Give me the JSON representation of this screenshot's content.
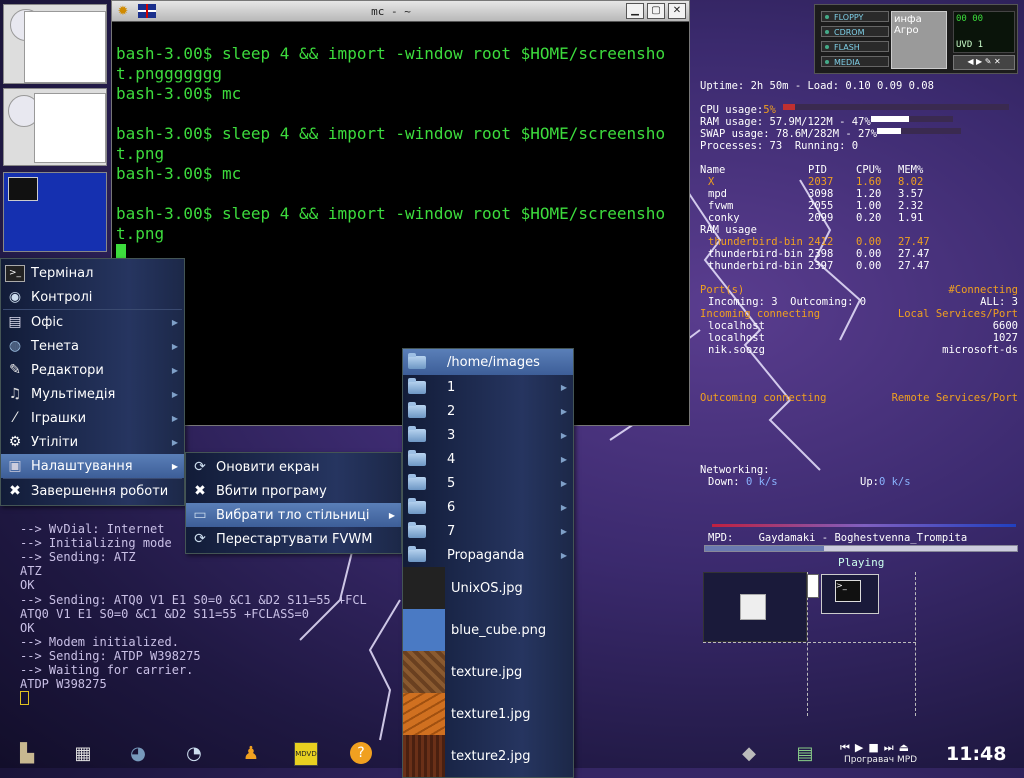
{
  "terminal": {
    "title": "mc - ~",
    "lines": [
      "bash-3.00$ sleep 4 && import -window root $HOME/screensho",
      "t.pnggggggg",
      "bash-3.00$ mc",
      "",
      "bash-3.00$ sleep 4 && import -window root $HOME/screensho",
      "t.png",
      "bash-3.00$ mc",
      "",
      "bash-3.00$ sleep 4 && import -window root $HOME/screensho",
      "t.png"
    ]
  },
  "console": {
    "lines": [
      "--> WvDial: Internet",
      "--> Initializing mode",
      "--> Sending: ATZ",
      "ATZ",
      "OK",
      "--> Sending: ATQ0 V1 E1 S0=0 &C1 &D2 S11=55 +FCL",
      "ATQ0 V1 E1 S0=0 &C1 &D2 S11=55 +FCLASS=0",
      "OK",
      "--> Modem initialized.",
      "--> Sending: ATDP W398275",
      "--> Waiting for carrier.",
      "ATDP W398275"
    ]
  },
  "main_menu": {
    "items": [
      {
        "label": "Термінал",
        "icon": "terminal-icon"
      },
      {
        "label": "Контролі",
        "icon": "globe-icon"
      },
      {
        "label": "Офіс",
        "icon": "document-icon"
      },
      {
        "label": "Тенета",
        "icon": "network-icon"
      },
      {
        "label": "Редактори",
        "icon": "editor-icon"
      },
      {
        "label": "Мультімедія",
        "icon": "multimedia-icon"
      },
      {
        "label": "Іграшки",
        "icon": "games-icon"
      },
      {
        "label": "Утіліти",
        "icon": "gear-icon"
      },
      {
        "label": "Налаштування",
        "icon": "settings-icon"
      },
      {
        "label": "Завершення роботи",
        "icon": "close-icon"
      }
    ]
  },
  "settings_menu": {
    "items": [
      {
        "label": "Оновити екран"
      },
      {
        "label": "Вбити програму"
      },
      {
        "label": "Вибрати тло стільниці"
      },
      {
        "label": "Перестартувати FVWM"
      }
    ]
  },
  "wallpaper_menu": {
    "header": "/home/images",
    "folders": [
      "1",
      "2",
      "3",
      "4",
      "5",
      "6",
      "7",
      "Propaganda"
    ],
    "images": [
      {
        "label": "UnixOS.jpg",
        "color": "#222"
      },
      {
        "label": "blue_cube.png",
        "color": "#4a7ac4"
      },
      {
        "label": "texture.jpg",
        "color": "#8a5a30"
      },
      {
        "label": "texture1.jpg",
        "color": "#d07020"
      },
      {
        "label": "texture2.jpg",
        "color": "#6a3018"
      }
    ]
  },
  "conky": {
    "uptime": "Uptime: 2h 50m - Load: 0.10 0.09 0.08",
    "cpu_label": "CPU usage:",
    "cpu_value": "5%",
    "cpu_fraction": 0.05,
    "ram_label": "RAM usage: 57.9M/122M - 47%",
    "ram_fraction": 0.47,
    "swap_label": "SWAP usage: 78.6M/282M - 27%",
    "swap_fraction": 0.27,
    "processes": "Processes: 73  Running: 0",
    "proc_header": [
      "Name",
      "PID",
      "CPU%",
      "MEM%"
    ],
    "proc_rows": [
      [
        "X",
        "2037",
        "1.60",
        "8.02"
      ],
      [
        "mpd",
        "3098",
        "1.20",
        "3.57"
      ],
      [
        "fvwm",
        "2055",
        "1.00",
        "2.32"
      ],
      [
        "conky",
        "2099",
        "0.20",
        "1.91"
      ]
    ],
    "ram_section": "RAM usage",
    "ram_rows": [
      [
        "thunderbird-bin",
        "2412",
        "0.00",
        "27.47"
      ],
      [
        "thunderbird-bin",
        "2398",
        "0.00",
        "27.47"
      ],
      [
        "thunderbird-bin",
        "2397",
        "0.00",
        "27.47"
      ]
    ],
    "ports_label": "Port(s)",
    "connecting": "#Connecting",
    "incoming_line": "Incoming: 3  Outcoming: 0",
    "all_line": "ALL: 3",
    "incoming_connecting": "Incoming connecting",
    "local_services": "Local Services/Port",
    "connections": [
      [
        "localhost",
        "6600"
      ],
      [
        "localhost",
        "1027"
      ],
      [
        "nik.soozg",
        "microsoft-ds"
      ]
    ],
    "outcoming_connecting": "Outcoming connecting",
    "remote_services": "Remote Services/Port",
    "networking": "Networking:",
    "down_label": "Down:",
    "down_value": "0 k/s",
    "up_label": "Up:",
    "up_value": "0 k/s",
    "mpd_label": "MPD:",
    "mpd_track": "Gaydamaki - Boghestvenna_Trompita",
    "mpd_status": "Playing"
  },
  "dock": {
    "buttons": [
      "FLOPPY",
      "CDROM",
      "FLASH",
      "MEDIA"
    ],
    "note_text": "инфа Агро",
    "clock_display": "00 00",
    "uvd": "UVD 1"
  },
  "taskbar": {
    "player_label": "Програвач MPD",
    "clock": "11:48"
  },
  "colors": {
    "terminal_text": "#3ddc3d",
    "menu_selected": "#4a6ea8",
    "conky_orange": "#f0a020"
  }
}
